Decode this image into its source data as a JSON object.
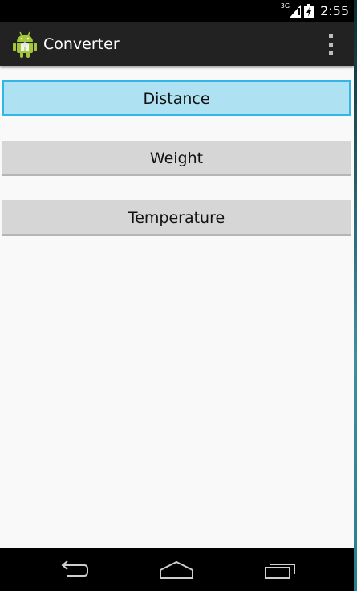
{
  "status_bar": {
    "network_type": "3G",
    "time": "2:55",
    "icons": [
      "signal-icon",
      "battery-icon"
    ]
  },
  "action_bar": {
    "title": "Converter",
    "icon": "android-app-icon",
    "menu_icon": "overflow-menu-icon",
    "background": "#222222"
  },
  "buttons": [
    {
      "label": "Distance",
      "state": "focused",
      "color": "#aee2f3"
    },
    {
      "label": "Weight",
      "state": "normal",
      "color": "#d6d6d6"
    },
    {
      "label": "Temperature",
      "state": "normal",
      "color": "#d6d6d6"
    }
  ],
  "nav_bar": {
    "icons": [
      "back-icon",
      "home-icon",
      "recent-apps-icon"
    ]
  },
  "colors": {
    "accent": "#33b5e5",
    "android_green": "#a4c639"
  }
}
